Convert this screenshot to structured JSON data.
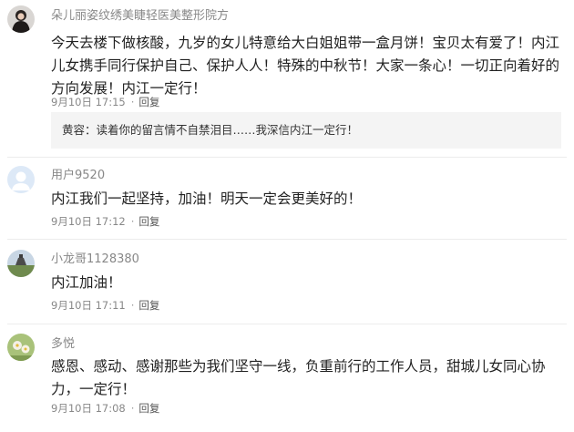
{
  "comments": [
    {
      "username": "朵儿丽姿纹绣美睫轻医美整形院方",
      "avatar": "avatar-woman-photo",
      "text": "今天去楼下做核酸，九岁的女儿特意给大白姐姐带一盒月饼！宝贝太有爱了！内江儿女携手同行保护自己、保护人人！特殊的中秋节！大家一条心！一切正向着好的方向发展！内江一定行！",
      "date": "9月10日",
      "time": "17:15",
      "reply_label": "回复",
      "reply_box": {
        "author": "黄容：",
        "text": "读着你的留言情不自禁泪目……我深信内江一定行！"
      }
    },
    {
      "username": "用户9520",
      "avatar": "avatar-default-user",
      "text": "内江我们一起坚持，加油！明天一定会更美好的！",
      "date": "9月10日",
      "time": "17:12",
      "reply_label": "回复"
    },
    {
      "username": "小龙哥1128380",
      "avatar": "avatar-landscape-photo",
      "text": "内江加油！",
      "date": "9月10日",
      "time": "17:11",
      "reply_label": "回复"
    },
    {
      "username": "多悦",
      "avatar": "avatar-flower-photo",
      "text": "感恩、感动、感谢那些为我们坚守一线，负重前行的工作人员，甜城儿女同心协力，一定行！",
      "date": "9月10日",
      "time": "17:08",
      "reply_label": "回复"
    }
  ],
  "colors": {
    "username": "#888888",
    "text": "#222222",
    "reply_box_bg": "#f4f4f4",
    "divider": "#ececec",
    "default_avatar_bg": "#dde9f7"
  }
}
